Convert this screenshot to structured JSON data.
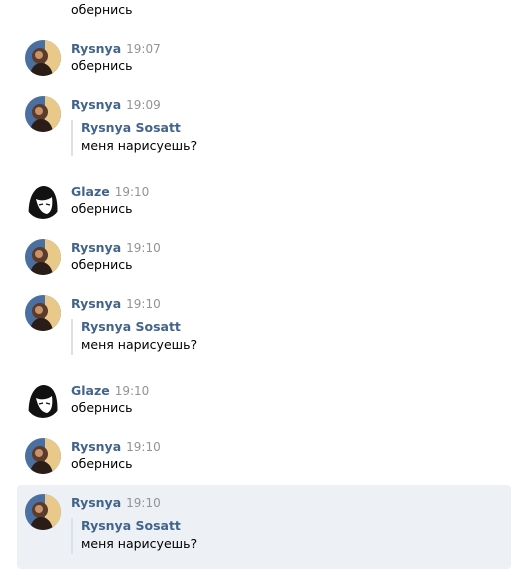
{
  "messages": [
    {
      "author": "",
      "time": "",
      "text": "обернись",
      "avatar": "glaze-avatar"
    },
    {
      "author": "Rysnya",
      "time": "19:07",
      "text": "обернись",
      "avatar": "rysnya-avatar"
    },
    {
      "author": "Rysnya",
      "time": "19:09",
      "forward": {
        "author": "Rysnya Sosatt",
        "text": "меня нарисуешь?"
      },
      "avatar": "rysnya-avatar"
    },
    {
      "author": "Glaze",
      "time": "19:10",
      "text": "обернись",
      "avatar": "glaze-avatar"
    },
    {
      "author": "Rysnya",
      "time": "19:10",
      "text": "обернись",
      "avatar": "rysnya-avatar"
    },
    {
      "author": "Rysnya",
      "time": "19:10",
      "forward": {
        "author": "Rysnya Sosatt",
        "text": "меня нарисуешь?"
      },
      "avatar": "rysnya-avatar"
    },
    {
      "author": "Glaze",
      "time": "19:10",
      "text": "обернись",
      "avatar": "glaze-avatar"
    },
    {
      "author": "Rysnya",
      "time": "19:10",
      "text": "обернись",
      "avatar": "rysnya-avatar"
    },
    {
      "author": "Rysnya",
      "time": "19:10",
      "forward": {
        "author": "Rysnya Sosatt",
        "text": "меня нарисуешь?"
      },
      "avatar": "rysnya-avatar"
    }
  ],
  "colors": {
    "author": "#42648b",
    "time": "#939393",
    "highlight": "#edf0f5",
    "forward_border": "#dae1e8"
  }
}
